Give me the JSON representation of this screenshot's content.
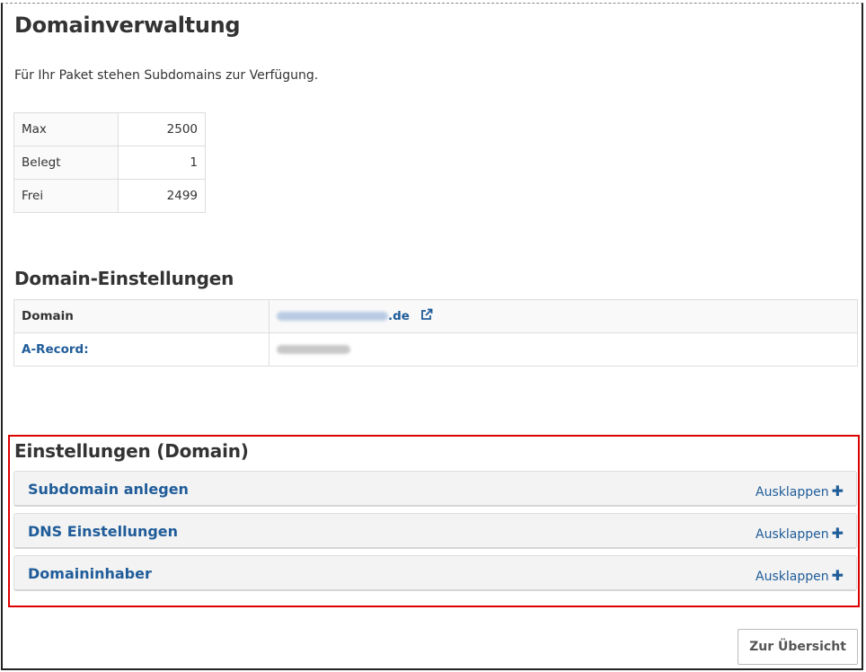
{
  "page_title": "Domainverwaltung",
  "intro_text": "Für Ihr Paket stehen Subdomains zur Verfügung.",
  "quota": [
    {
      "label": "Max",
      "value": "2500"
    },
    {
      "label": "Belegt",
      "value": "1"
    },
    {
      "label": "Frei",
      "value": "2499"
    }
  ],
  "domain_settings": {
    "title": "Domain-Einstellungen",
    "rows": [
      {
        "label": "Domain",
        "value_suffix": "de"
      },
      {
        "label": "A-Record:"
      }
    ],
    "external_link_icon": "external-link-icon"
  },
  "domain_options": {
    "title": "Einstellungen (Domain)",
    "expand_label": "Ausklappen",
    "panels": [
      {
        "title": "Subdomain anlegen"
      },
      {
        "title": "DNS Einstellungen"
      },
      {
        "title": "Domaininhaber"
      }
    ]
  },
  "back_button": "Zur Übersicht",
  "colors": {
    "link": "#1f5c99",
    "highlight_border": "#dd0000",
    "panel_bg": "#f3f3f3"
  }
}
